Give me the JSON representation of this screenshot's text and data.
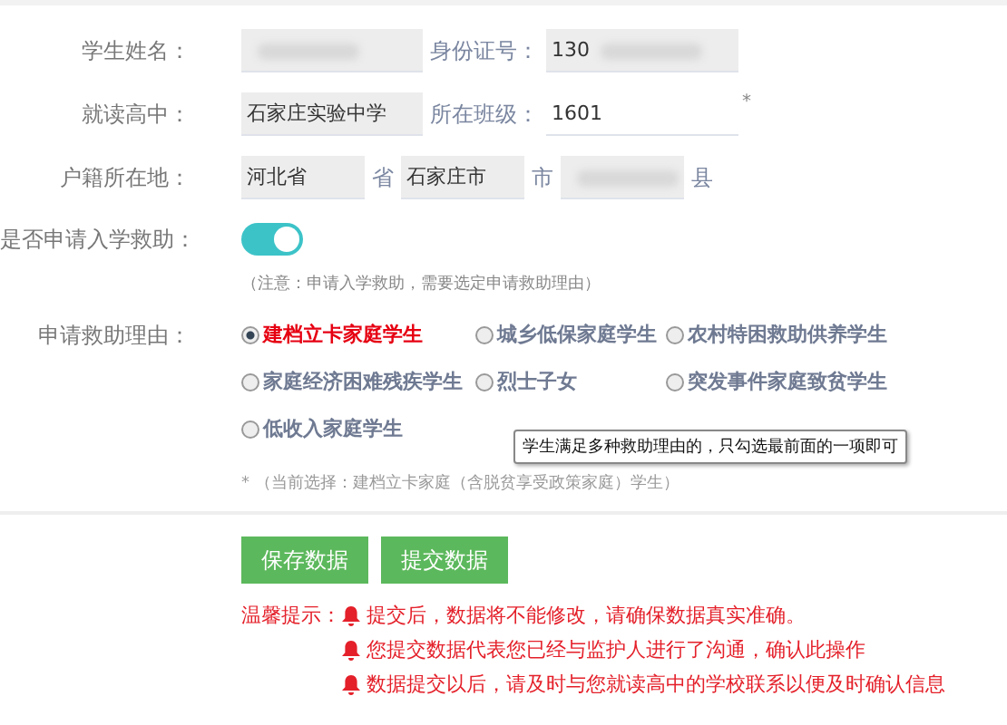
{
  "rows": [
    {
      "kind": "fields",
      "label": "学生姓名：",
      "fields": [
        {
          "redacted": true,
          "underline": false
        },
        {
          "label": "身份证号：",
          "value": "130",
          "redacted": true,
          "underline": false
        }
      ]
    },
    {
      "kind": "fields",
      "label": "就读高中：",
      "fields": [
        {
          "value": "石家庄实验中学",
          "redacted": false,
          "underline": false
        },
        {
          "label": "所在班级：",
          "value": "1601",
          "redacted": false,
          "underline": true,
          "required_mark": "*"
        }
      ]
    },
    {
      "kind": "address",
      "label": "户籍所在地：",
      "parts": [
        {
          "value": "河北省",
          "suffix": "省",
          "redacted": false
        },
        {
          "value": "石家庄市",
          "suffix": "市",
          "redacted": false
        },
        {
          "suffix": "县",
          "redacted": true
        }
      ]
    }
  ],
  "aid_toggle": {
    "label": "是否申请入学救助：",
    "on": true,
    "note": "（注意：申请入学救助，需要选定申请救助理由）"
  },
  "reasons": {
    "label": "申请救助理由：",
    "options": [
      {
        "label": "建档立卡家庭学生",
        "selected": true
      },
      {
        "label": "城乡低保家庭学生",
        "selected": false
      },
      {
        "label": "农村特困救助供养学生",
        "selected": false
      },
      {
        "label": "家庭经济困难残疾学生",
        "selected": false
      },
      {
        "label": "烈士子女",
        "selected": false
      },
      {
        "label": "突发事件家庭致贫学生",
        "selected": false
      },
      {
        "label": "低收入家庭学生",
        "selected": false
      }
    ],
    "tooltip": "学生满足多种救助理由的，只勾选最前面的一项即可",
    "current": "*  （当前选择：建档立卡家庭（含脱贫享受政策家庭）学生）"
  },
  "buttons": [
    "保存数据",
    "提交数据"
  ],
  "tips": {
    "label": "温馨提示：",
    "items": [
      "提交后，数据将不能修改，请确保数据真实准确。",
      "您提交数据代表您已经与监护人进行了沟通，确认此操作",
      "数据提交以后，请及时与您就读高中的学校联系以便及时确认信息"
    ]
  }
}
